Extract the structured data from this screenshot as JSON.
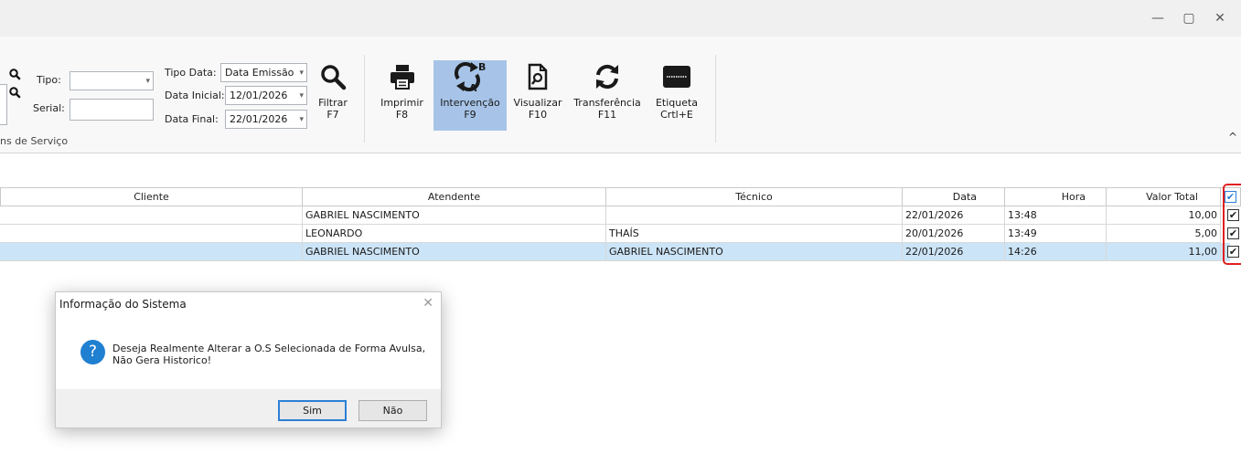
{
  "window": {
    "minimize": "—",
    "restore": "▢",
    "close": "✕"
  },
  "filters": {
    "tipo_label": "Tipo:",
    "tipo_value": "",
    "serial_label": "Serial:",
    "serial_value": "",
    "tipo_data_label": "Tipo Data:",
    "tipo_data_value": "Data Emissão",
    "data_inicial_label": "Data Inicial:",
    "data_inicial_value": "12/01/2026",
    "data_final_label": "Data Final:",
    "data_final_value": "22/01/2026"
  },
  "toolbar": {
    "filtrar": {
      "line1": "Filtrar",
      "line2": "F7"
    },
    "imprimir": {
      "line1": "Imprimir",
      "line2": "F8"
    },
    "intervencao": {
      "line1": "Intervenção",
      "line2": "F9"
    },
    "visualizar": {
      "line1": "Visualizar",
      "line2": "F10"
    },
    "transferencia": {
      "line1": "Transferência",
      "line2": "F11"
    },
    "etiqueta": {
      "line1": "Etiqueta",
      "line2": "Crtl+E"
    },
    "group_label": "ns de Serviço",
    "collapse": "^"
  },
  "table": {
    "headers": {
      "cliente": "Cliente",
      "atendente": "Atendente",
      "tecnico": "Técnico",
      "data": "Data",
      "hora": "Hora",
      "valor_total": "Valor Total"
    },
    "rows": [
      {
        "cliente": "",
        "atendente": "GABRIEL NASCIMENTO",
        "tecnico": "",
        "data": "22/01/2026",
        "hora": "13:48",
        "valor_total": "10,00",
        "check": "✔"
      },
      {
        "cliente": "",
        "atendente": "LEONARDO",
        "tecnico": "THAÍS",
        "data": "20/01/2026",
        "hora": "13:49",
        "valor_total": "5,00",
        "check": "✔"
      },
      {
        "cliente": "",
        "atendente": "GABRIEL NASCIMENTO",
        "tecnico": "GABRIEL NASCIMENTO",
        "data": "22/01/2026",
        "hora": "14:26",
        "valor_total": "11,00",
        "check": "✔"
      }
    ],
    "header_check": "✔"
  },
  "dialog": {
    "title": "Informação do Sistema",
    "close": "✕",
    "icon": "?",
    "message_line1": "Deseja Realmente Alterar a O.S Selecionada de Forma Avulsa,",
    "message_line2": "Não Gera Historico!",
    "yes": "Sim",
    "no": "Não"
  },
  "colors": {
    "selected_row": "#cce4f7",
    "active_button": "#a7c4e8",
    "highlight_border": "#e02020",
    "question_icon": "#1f7fd0"
  },
  "icons": {
    "search": "search-icon",
    "printer": "printer-icon",
    "intervention": "intervention-icon",
    "preview": "document-search-icon",
    "transfer": "refresh-icon",
    "label": "barcode-label-icon",
    "question": "question-icon"
  }
}
